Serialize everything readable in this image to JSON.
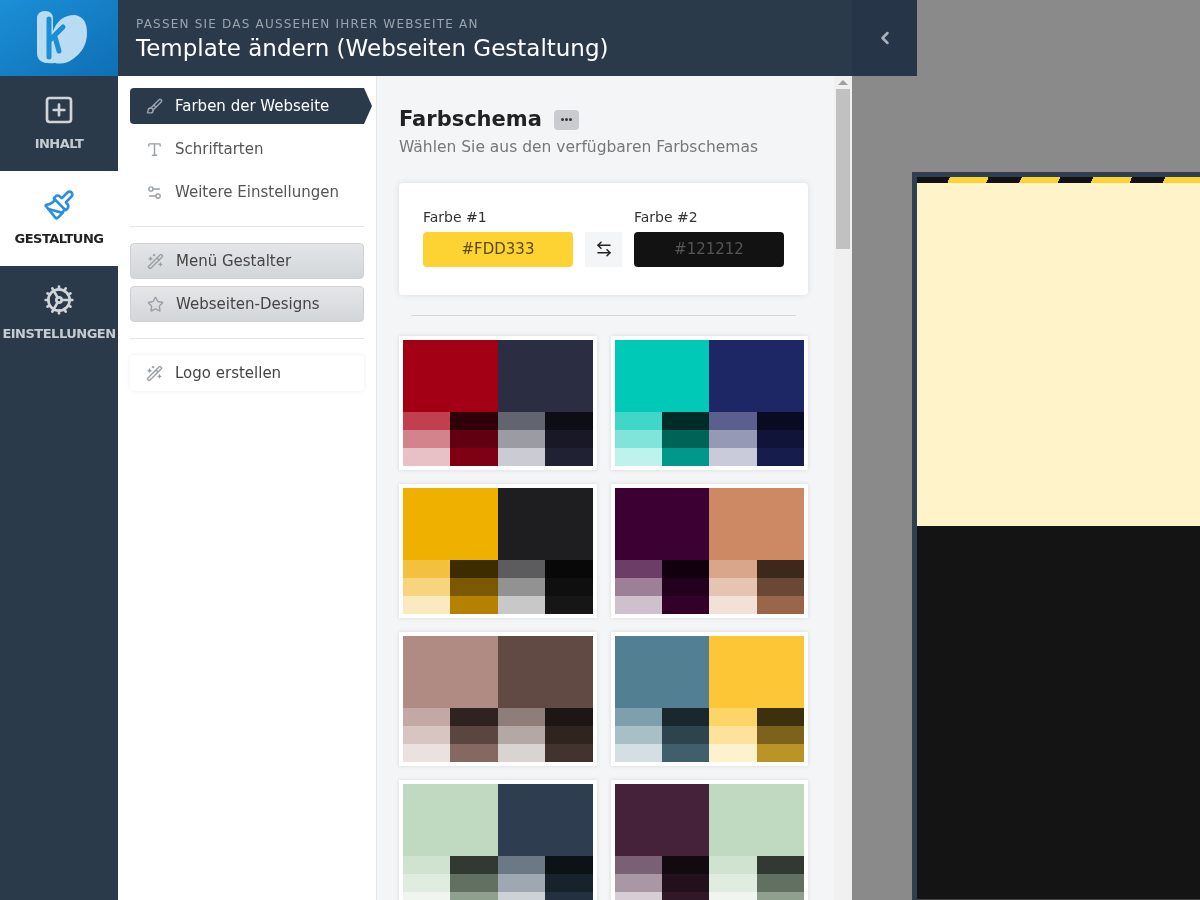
{
  "header": {
    "subtitle": "PASSEN SIE DAS AUSSEHEN IHRER WEBSEITE AN",
    "title": "Template ändern (Webseiten Gestaltung)"
  },
  "rail": [
    {
      "label": "INHALT",
      "selected": false
    },
    {
      "label": "GESTALTUNG",
      "selected": true
    },
    {
      "label": "EINSTELLUNGEN",
      "selected": false
    }
  ],
  "menu_groups": [
    {
      "kind": "nav",
      "items": [
        {
          "label": "Farben der Webseite",
          "selected": true
        },
        {
          "label": "Schriftarten",
          "selected": false
        },
        {
          "label": "Weitere Einstellungen",
          "selected": false
        }
      ]
    },
    {
      "kind": "tool",
      "items": [
        {
          "label": "Menü Gestalter",
          "selected": false
        },
        {
          "label": "Webseiten-Designs",
          "selected": false
        }
      ]
    },
    {
      "kind": "card",
      "items": [
        {
          "label": "Logo erstellen",
          "selected": false
        }
      ]
    }
  ],
  "scheme": {
    "title": "Farbschema",
    "subtitle": "Wählen Sie aus den verfügbaren Farbschemas",
    "color_1": {
      "label": "Farbe #1",
      "value": "#FDD333",
      "color": "#fdd333"
    },
    "color_2": {
      "label": "Farbe #2",
      "value": "#121212",
      "color": "#121212"
    }
  },
  "palettes": [
    {
      "main": [
        {
          "color": "#a30016"
        },
        {
          "color": "#2b2d42"
        }
      ],
      "shades": [
        [
          {
            "color": "#c0404f"
          },
          {
            "color": "#300008"
          },
          {
            "color": "#62646f"
          },
          {
            "color": "#0d0d16"
          }
        ],
        [
          {
            "color": "#d4838c"
          },
          {
            "color": "#600010"
          },
          {
            "color": "#9a9ba3"
          },
          {
            "color": "#181826"
          }
        ],
        [
          {
            "color": "#e8c1c6"
          },
          {
            "color": "#7f0013"
          },
          {
            "color": "#cbccd3"
          },
          {
            "color": "#202233"
          }
        ]
      ]
    },
    {
      "main": [
        {
          "color": "#00c9b7"
        },
        {
          "color": "#1e2766"
        }
      ],
      "shades": [
        [
          {
            "color": "#40d6c8"
          },
          {
            "color": "#002c28"
          },
          {
            "color": "#5a5f8e"
          },
          {
            "color": "#080b22"
          }
        ],
        [
          {
            "color": "#80e4db"
          },
          {
            "color": "#006358"
          },
          {
            "color": "#9599b5"
          },
          {
            "color": "#0f1438"
          }
        ],
        [
          {
            "color": "#bff1ed"
          },
          {
            "color": "#00988a"
          },
          {
            "color": "#c9cbdb"
          },
          {
            "color": "#161d4d"
          }
        ]
      ]
    },
    {
      "main": [
        {
          "color": "#f0b000"
        },
        {
          "color": "#1e1e20"
        }
      ],
      "shades": [
        [
          {
            "color": "#f3c13f"
          },
          {
            "color": "#3d2c00"
          },
          {
            "color": "#5c5c5e"
          },
          {
            "color": "#080808"
          }
        ],
        [
          {
            "color": "#f7d57f"
          },
          {
            "color": "#7a5800"
          },
          {
            "color": "#929293"
          },
          {
            "color": "#0f0f10"
          }
        ],
        [
          {
            "color": "#fbeabf"
          },
          {
            "color": "#b48200"
          },
          {
            "color": "#c8c8c9"
          },
          {
            "color": "#161617"
          }
        ]
      ]
    },
    {
      "main": [
        {
          "color": "#3c0033"
        },
        {
          "color": "#cd8864"
        }
      ],
      "shades": [
        [
          {
            "color": "#6c3d66"
          },
          {
            "color": "#12000f"
          },
          {
            "color": "#daa68b"
          },
          {
            "color": "#3d281d"
          }
        ],
        [
          {
            "color": "#9d7f98"
          },
          {
            "color": "#24001f"
          },
          {
            "color": "#e6c4b2"
          },
          {
            "color": "#6b4735"
          }
        ],
        [
          {
            "color": "#cec0cc"
          },
          {
            "color": "#330029"
          },
          {
            "color": "#f3e1d8"
          },
          {
            "color": "#9a664b"
          }
        ]
      ]
    },
    {
      "main": [
        {
          "color": "#b08b84"
        },
        {
          "color": "#614a43"
        }
      ],
      "shades": [
        [
          {
            "color": "#c4a8a3"
          },
          {
            "color": "#2e2320"
          },
          {
            "color": "#8e7d78"
          },
          {
            "color": "#1d1614"
          }
        ],
        [
          {
            "color": "#d8c5c2"
          },
          {
            "color": "#5a4540"
          },
          {
            "color": "#b3a8a4"
          },
          {
            "color": "#30241f"
          }
        ],
        [
          {
            "color": "#ebe2e0"
          },
          {
            "color": "#866862"
          },
          {
            "color": "#d9d3d1"
          },
          {
            "color": "#42332e"
          }
        ]
      ]
    },
    {
      "main": [
        {
          "color": "#537f92"
        },
        {
          "color": "#fcc636"
        }
      ],
      "shades": [
        [
          {
            "color": "#7e9fad"
          },
          {
            "color": "#1a272d"
          },
          {
            "color": "#fdd468"
          },
          {
            "color": "#3d300d"
          }
        ],
        [
          {
            "color": "#a9bfc8"
          },
          {
            "color": "#2d444e"
          },
          {
            "color": "#fee29b"
          },
          {
            "color": "#7c621a"
          }
        ],
        [
          {
            "color": "#d4dfe4"
          },
          {
            "color": "#3f5f6c"
          },
          {
            "color": "#fef1cd"
          },
          {
            "color": "#bb9428"
          }
        ]
      ]
    },
    {
      "main": [
        {
          "color": "#c0d9c1"
        },
        {
          "color": "#2e3e50"
        }
      ],
      "shades": [
        [
          {
            "color": "#d0e3d0"
          },
          {
            "color": "#323832"
          },
          {
            "color": "#6b7885"
          },
          {
            "color": "#0d1216"
          }
        ],
        [
          {
            "color": "#e0ece0"
          },
          {
            "color": "#617060"
          },
          {
            "color": "#9fa8b0"
          },
          {
            "color": "#18222c"
          }
        ],
        [
          {
            "color": "#f0f5f0"
          },
          {
            "color": "#8fa08f"
          },
          {
            "color": "#cdd2d7"
          },
          {
            "color": "#223040"
          }
        ]
      ]
    },
    {
      "main": [
        {
          "color": "#45213a"
        },
        {
          "color": "#c0d9c1"
        }
      ],
      "shades": [
        [
          {
            "color": "#7a6074"
          },
          {
            "color": "#120911"
          },
          {
            "color": "#d0e3d0"
          },
          {
            "color": "#323832"
          }
        ],
        [
          {
            "color": "#a997a5"
          },
          {
            "color": "#22101c"
          },
          {
            "color": "#e0ece0"
          },
          {
            "color": "#617060"
          }
        ],
        [
          {
            "color": "#d7cdd4"
          },
          {
            "color": "#311828"
          },
          {
            "color": "#f0f5f0"
          },
          {
            "color": "#8fa08f"
          }
        ]
      ]
    }
  ]
}
